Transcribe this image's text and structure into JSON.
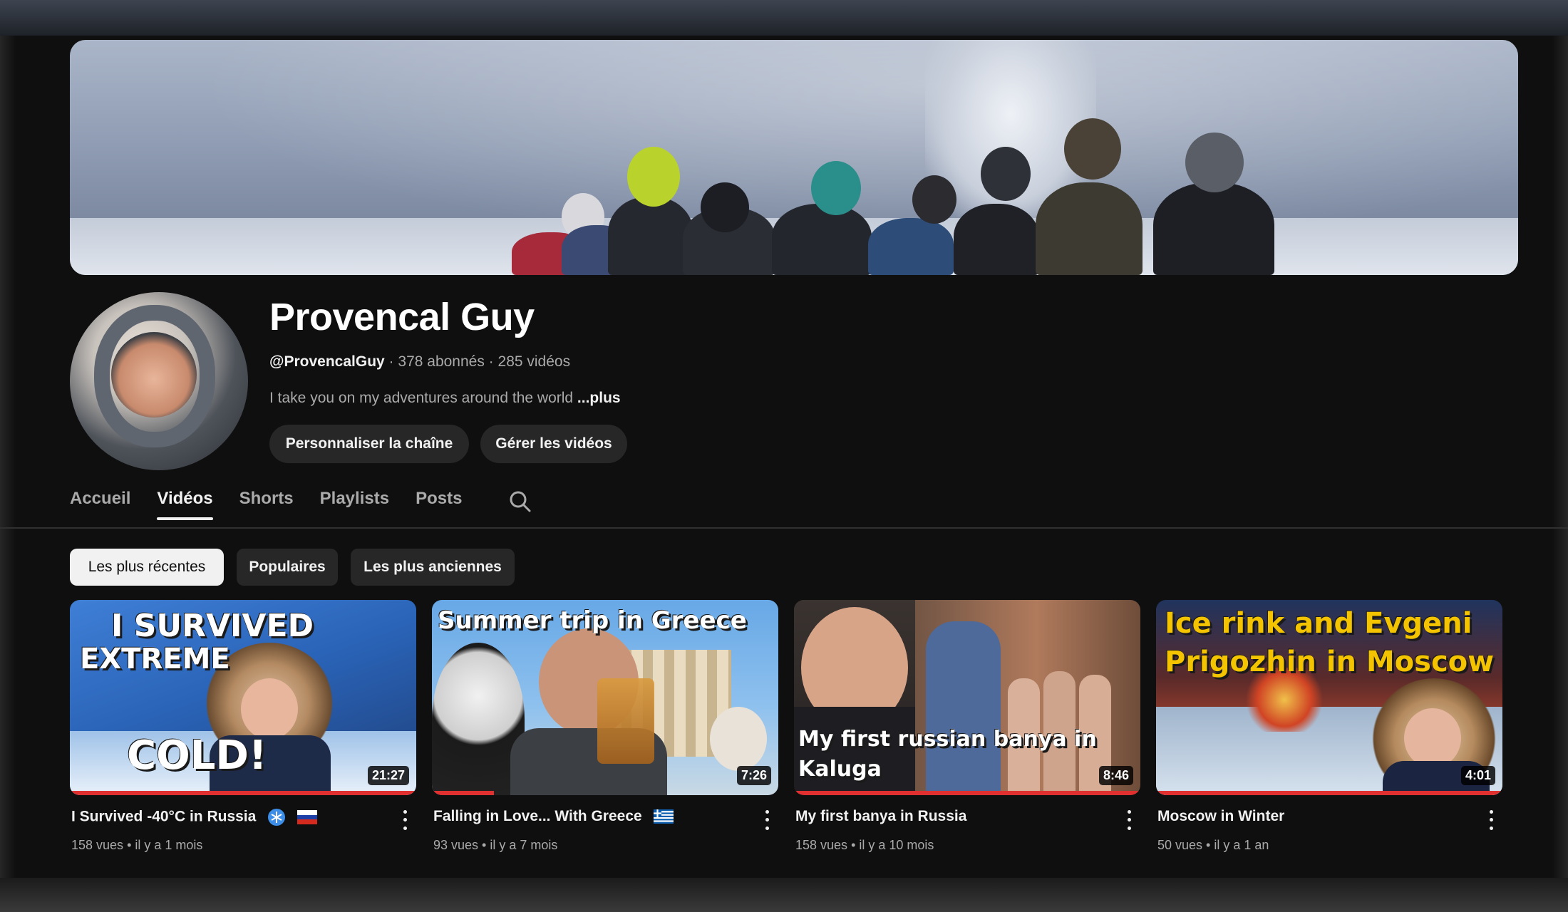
{
  "channel": {
    "name": "Provencal Guy",
    "handle": "@ProvencalGuy",
    "subscribers": "378 abonnés",
    "videos_count": "285 vidéos",
    "separator": " · ",
    "description": "I take you on my adventures around the world ",
    "more_label": "...plus"
  },
  "actions": {
    "customize_label": "Personnaliser la chaîne",
    "manage_label": "Gérer les vidéos"
  },
  "tabs": [
    {
      "label": "Accueil",
      "active": false
    },
    {
      "label": "Vidéos",
      "active": true
    },
    {
      "label": "Shorts",
      "active": false
    },
    {
      "label": "Playlists",
      "active": false
    },
    {
      "label": "Posts",
      "active": false
    }
  ],
  "chips": [
    {
      "label": "Les plus récentes",
      "selected": true
    },
    {
      "label": "Populaires",
      "selected": false
    },
    {
      "label": "Les plus anciennes",
      "selected": false
    }
  ],
  "videos": [
    {
      "title": "I Survived -40°C in Russia",
      "views": "158 vues",
      "age": "il y a 1 mois",
      "meta_sep": " • ",
      "duration": "21:27",
      "overlay_lines": [
        "I SURVIVED",
        "EXTREME",
        "COLD!"
      ],
      "flag": "russia-flag-icon"
    },
    {
      "title": "Falling in Love... With Greece",
      "views": "93 vues",
      "age": "il y a 7 mois",
      "meta_sep": " • ",
      "duration": "7:26",
      "overlay_lines": [
        "Summer trip in Greece"
      ],
      "flag": "greece-flag-icon"
    },
    {
      "title": "My first banya in Russia",
      "views": "158 vues",
      "age": "il y a 10 mois",
      "meta_sep": " • ",
      "duration": "8:46",
      "overlay_lines": [
        "My first russian banya in",
        "Kaluga"
      ]
    },
    {
      "title": "Moscow in Winter",
      "views": "50 vues",
      "age": "il y a 1 an",
      "meta_sep": " • ",
      "duration": "4:01",
      "overlay_lines": [
        "Ice rink and Evgeni",
        "Prigozhin in Moscow"
      ]
    }
  ],
  "colors": {
    "background": "#0f0f0f",
    "text_primary": "#f1f1f1",
    "text_secondary": "#aaaaaa",
    "chip_bg": "#272727",
    "progress": "#e03030"
  }
}
